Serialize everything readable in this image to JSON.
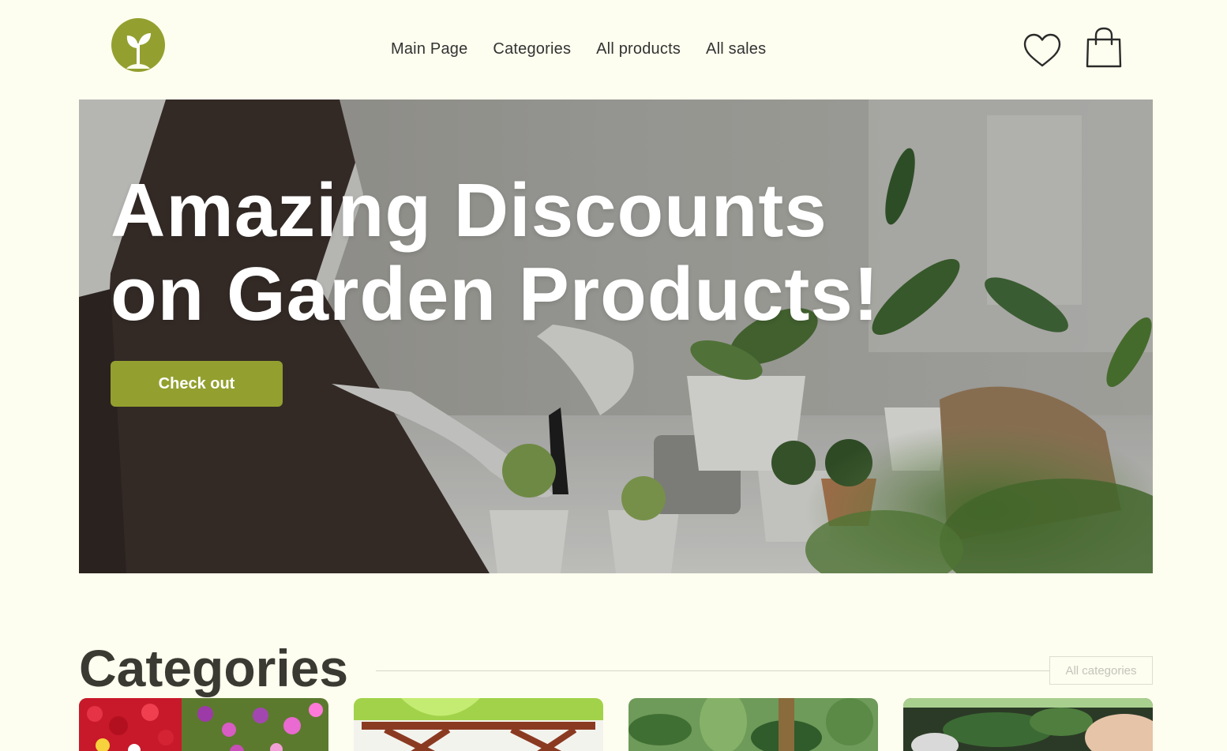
{
  "header": {
    "logo_icon": "sprout-logo-icon",
    "nav": [
      {
        "label": "Main Page"
      },
      {
        "label": "Categories"
      },
      {
        "label": "All products"
      },
      {
        "label": "All sales"
      }
    ],
    "favorites_icon": "heart-icon",
    "cart_icon": "shopping-bag-icon"
  },
  "hero": {
    "title_line1": "Amazing Discounts",
    "title_line2": "on Garden Products!",
    "cta_label": "Check out"
  },
  "categories": {
    "title": "Categories",
    "all_label": "All categories",
    "cards": [
      {
        "image": "flower-bed-image"
      },
      {
        "image": "garden-pergola-image"
      },
      {
        "image": "tropical-plants-image"
      },
      {
        "image": "potted-plant-image"
      }
    ]
  },
  "colors": {
    "background": "#fdfeef",
    "accent": "#93a02f",
    "heading": "#3a3a33"
  }
}
